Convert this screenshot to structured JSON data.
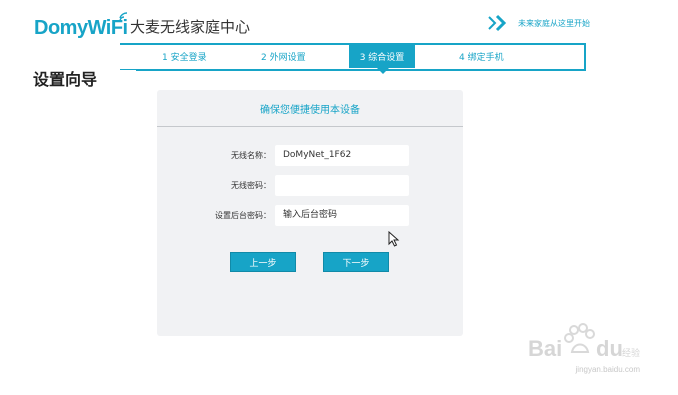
{
  "header": {
    "logo_text": "DomyWiFi",
    "brand_title": "大麦无线家庭中心",
    "top_link": "未来家庭从这里开始",
    "accent_color": "#17a4c7"
  },
  "steps": [
    {
      "label": "1 安全登录"
    },
    {
      "label": "2 外网设置"
    },
    {
      "label": "3 综合设置",
      "active": true
    },
    {
      "label": "4 绑定手机"
    }
  ],
  "wizard_title": "设置向导",
  "panel": {
    "heading": "确保您便捷使用本设备",
    "fields": [
      {
        "label": "无线名称：",
        "value": "DoMyNet_1F62",
        "placeholder": ""
      },
      {
        "label": "无线密码：",
        "value": "",
        "placeholder": ""
      },
      {
        "label": "设置后台密码：",
        "value": "",
        "placeholder": "输入后台密码"
      }
    ],
    "prev_button": "上一步",
    "next_button": "下一步"
  },
  "watermark": {
    "brand": "Baidu经验",
    "url": "jingyan.baidu.com"
  }
}
